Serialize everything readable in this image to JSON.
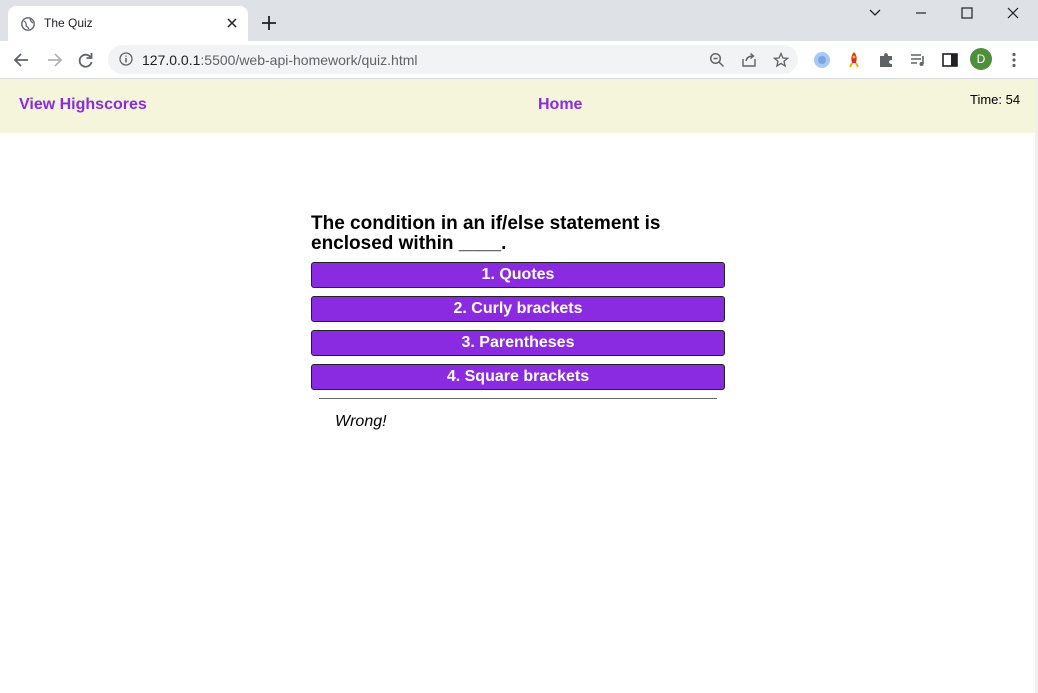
{
  "browser": {
    "tab_title": "The Quiz",
    "url_host": "127.0.0.1",
    "url_rest": ":5500/web-api-homework/quiz.html",
    "avatar_letter": "D"
  },
  "header": {
    "highscores_label": "View Highscores",
    "home_label": "Home",
    "timer_text": "Time: 54"
  },
  "quiz": {
    "question": "The condition in an if/else statement is enclosed within ____.",
    "choices": [
      "1. Quotes",
      "2. Curly brackets",
      "3. Parentheses",
      "4. Square brackets"
    ],
    "feedback": "Wrong!"
  },
  "colors": {
    "accent": "#8a2be2",
    "header_bg": "#f5f5dc"
  }
}
